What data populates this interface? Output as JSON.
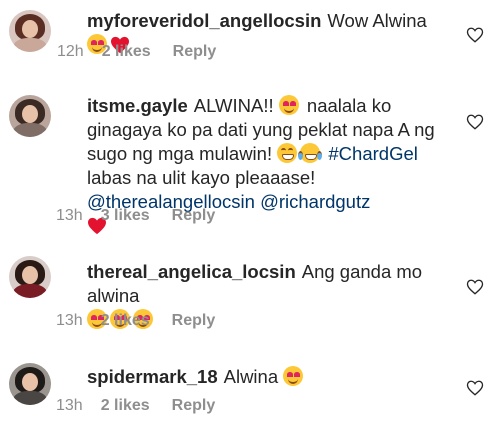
{
  "comments": [
    {
      "username": "myforeveridol_angellocsin",
      "text": "Wow Alwina",
      "time": "12h",
      "likes": "2 likes",
      "reply": "Reply"
    },
    {
      "username": "itsme.gayle",
      "text_a": "ALWINA!!",
      "text_b": "naalala ko ginagaya ko pa dati yung peklat napa A ng sugo ng mga mulawin!",
      "hashtag": "#ChardGel",
      "text_c": "labas na ulit kayo pleaaase!",
      "mention1": "@therealangellocsin",
      "mention2": "@richardgutz",
      "time": "13h",
      "likes": "3 likes",
      "reply": "Reply"
    },
    {
      "username": "thereal_angelica_locsin",
      "text": "Ang ganda mo alwina",
      "time": "13h",
      "likes": "2 likes",
      "reply": "Reply"
    },
    {
      "username": "spidermark_18",
      "text": "Alwina",
      "time": "13h",
      "likes": "2 likes",
      "reply": "Reply"
    }
  ],
  "colors": {
    "text": "#262626",
    "meta": "#8e8e8e",
    "link": "#003569",
    "heart": "#ed4956"
  },
  "icons": {
    "like": "heart-outline-icon",
    "emoji_love": "heart-eyes-emoji",
    "emoji_grin": "grinning-emoji",
    "emoji_tears": "tears-of-joy-emoji",
    "emoji_heart": "red-heart-emoji"
  }
}
